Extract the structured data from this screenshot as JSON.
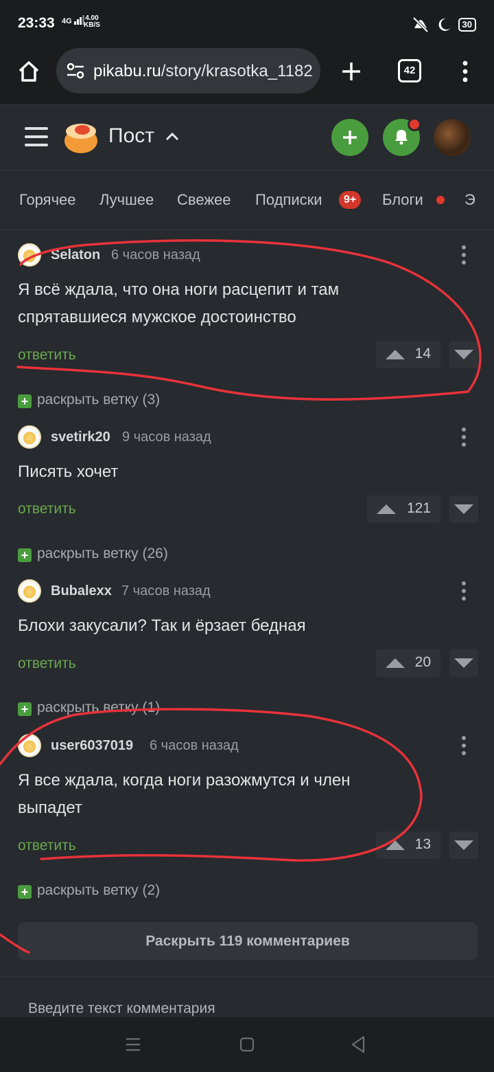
{
  "status_bar": {
    "time": "23:33",
    "network": "4G",
    "speed_value": "4.00",
    "speed_unit": "KB/S",
    "battery": "30"
  },
  "browser": {
    "url_host": "pikabu.ru",
    "url_path": "/story/krasotka_1182",
    "tab_count": "42"
  },
  "header": {
    "title": "Пост"
  },
  "tabs": [
    {
      "label": "Горячее"
    },
    {
      "label": "Лучшее"
    },
    {
      "label": "Свежее"
    },
    {
      "label": "Подписки",
      "badge": "9+"
    },
    {
      "label": "Блоги"
    },
    {
      "label": "Э"
    }
  ],
  "comments": [
    {
      "author": "Selaton",
      "time": "6 часов назад",
      "text": "Я всё ждала, что она ноги расцепит и там спрятавшиеся мужское достоинство",
      "reply": "ответить",
      "rating": "14",
      "expand": "раскрыть ветку (3)"
    },
    {
      "author": "svetirk20",
      "time": "9 часов назад",
      "text": "Писять хочет",
      "reply": "ответить",
      "rating": "121",
      "expand": "раскрыть ветку (26)"
    },
    {
      "author": "Bubalexx",
      "time": "7 часов назад",
      "text": "Блохи закусали? Так и ёрзает бедная",
      "reply": "ответить",
      "rating": "20",
      "expand": "раскрыть ветку (1)"
    },
    {
      "author": "user6037019",
      "time": "6 часов назад",
      "text": "Я все ждала, когда ноги разожмутся и член выпадет",
      "reply": "ответить",
      "rating": "13",
      "expand": "раскрыть ветку (2)"
    }
  ],
  "show_all": "Раскрыть 119 комментариев",
  "comment_input": {
    "placeholder": "Введите текст комментария"
  },
  "colors": {
    "background": "#272a2e",
    "accent_green": "#4a9d3e",
    "reply_green": "#6aa84f",
    "badge_red": "#d2372b",
    "annotation_red": "#e8323a"
  },
  "icons": [
    "home-icon",
    "site-settings-icon",
    "plus-icon",
    "tabs-icon",
    "more-vert-icon",
    "menu-icon",
    "pikabu-logo",
    "chevron-up-icon",
    "bell-icon",
    "arrow-up-icon",
    "arrow-down-icon"
  ]
}
